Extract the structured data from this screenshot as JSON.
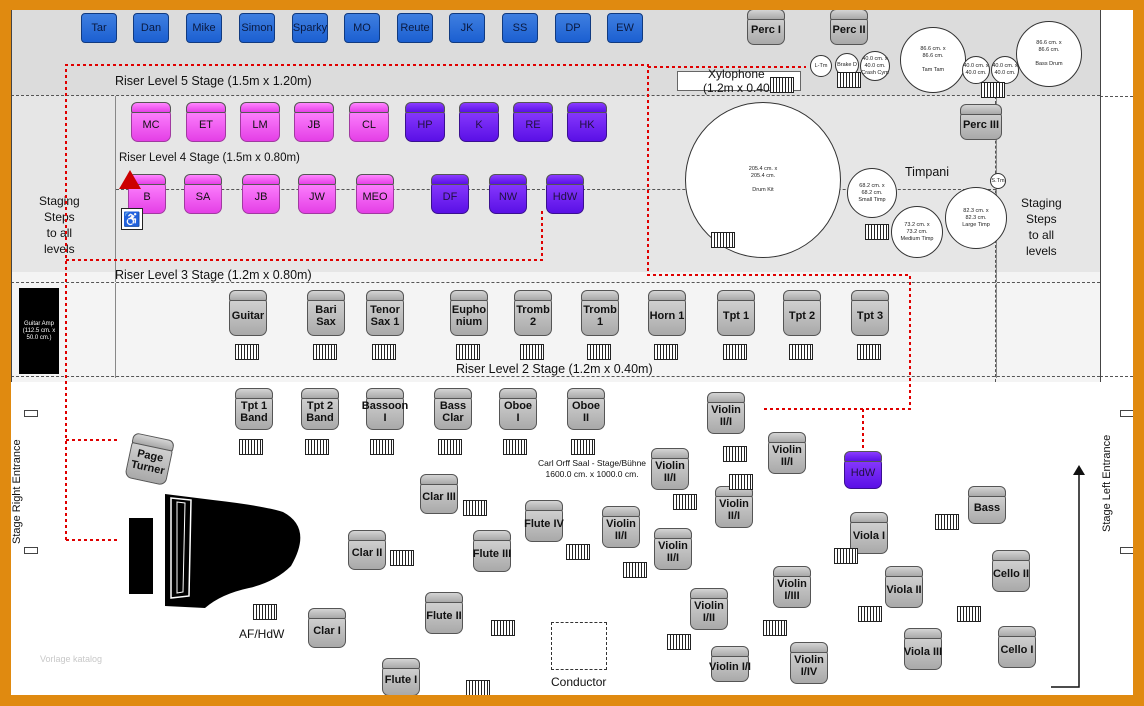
{
  "riser_labels": {
    "level5": "Riser Level 5 Stage (1.5m x 1.20m)",
    "level4": "Riser Level 4 Stage (1.5m x 0.80m)",
    "level3": "Riser Level 3 Stage (1.2m x 0.80m)",
    "level2": "Riser Level 2 Stage (1.2m x 0.40m)"
  },
  "staging_left": "Staging\nSteps\nto all\nlevels",
  "staging_right": "Staging\nSteps\nto all\nlevels",
  "xylophone": "Xylophone\n(1.2m x 0.40",
  "timpani": "Timpani",
  "hall": "Carl Orff Saal - Stage/Bühne\n1600.0 cm. x 1000.0 cm.",
  "conductor": "Conductor",
  "af_hdw": "AF/HdW",
  "page_turner": "Page\nTurner",
  "guitar_amp": "Guitar Amp\n(112.5 cm. x\n50.0 cm.)",
  "entrance_right": "Stage Right Entrance",
  "entrance_left": "Stage Left Entrance",
  "watermark": "Vorlage katalog",
  "top_row": [
    "Tar",
    "Dan",
    "Mike",
    "Simon",
    "Sparky",
    "MO",
    "Reute",
    "JK",
    "SS",
    "DP",
    "EW"
  ],
  "perc": [
    "Perc I",
    "Perc II",
    "Perc III"
  ],
  "riser4_row1": [
    "MC",
    "ET",
    "LM",
    "JB",
    "CL",
    "HP",
    "K",
    "RE",
    "HK"
  ],
  "riser4_row2": [
    "B",
    "SA",
    "JB",
    "JW",
    "MEO",
    "DF",
    "NW",
    "HdW"
  ],
  "riser3_row": [
    "Guitar",
    "Bari\nSax",
    "Tenor\nSax 1",
    "Eupho\nnium",
    "Tromb\n2",
    "Tromb\n1",
    "Horn 1",
    "Tpt 1",
    "Tpt 2",
    "Tpt 3"
  ],
  "floor_row1": [
    "Tpt 1\nBand",
    "Tpt 2\nBand",
    "Bassoon\nI",
    "Bass\nClar",
    "Oboe\nI",
    "Oboe\nII"
  ],
  "floor_other": {
    "violin1": "Violin\nII/I",
    "violin2": "Violin\nII/I",
    "violin3": "Violin\nII/I",
    "violin4": "Violin\nII/I",
    "violin5": "Violin\nII/I",
    "violin6": "Violin\nII/I",
    "violin7": "Violin\nI/III",
    "violin8": "Violin\nI/II",
    "violin9": "Violin I/I",
    "violin10": "Violin\nI/IV",
    "hdw": "HdW",
    "clar3": "Clar III",
    "clar2": "Clar II",
    "clar1": "Clar I",
    "flute4": "Flute IV",
    "flute3": "Flute III",
    "flute2": "Flute II",
    "flute1": "Flute I",
    "bass": "Bass",
    "viola1": "Viola I",
    "viola2": "Viola II",
    "viola3": "Viola III",
    "cello2": "Cello II",
    "cello1": "Cello I"
  },
  "drums": {
    "kit": "205.4 cm. x\n205.4 cm.\n\nDrum Kit",
    "tamtam": "86.6 cm. x\n86.6 cm.\n\nTam Tam",
    "bassdrum": "86.6 cm. x\n86.6 cm.\n\nBass Drum",
    "small_timp": "68.2 cm. x\n68.2 cm.\nSmall Timp",
    "medium_timp": "73.2 cm. x\n73.2 cm.\nMedium Timp",
    "large_timp": "82.3 cm. x\n82.3 cm.\nLarge Timp",
    "small1": "L-Tm",
    "small2": "Brake D",
    "small3": "40.0 cm. x\n40.0 cm.\nCrash Cym",
    "small4": "40.0 cm. x\n40.0 cm.",
    "small5": "40.0 cm. x\n40.0 cm.",
    "small6": "S.Tm"
  },
  "colors": {
    "frame": "#e08a10",
    "pink": "#ee55ee",
    "purple": "#6a1cf0",
    "blue": "#2a6ed8",
    "red_path": "#e00000"
  }
}
